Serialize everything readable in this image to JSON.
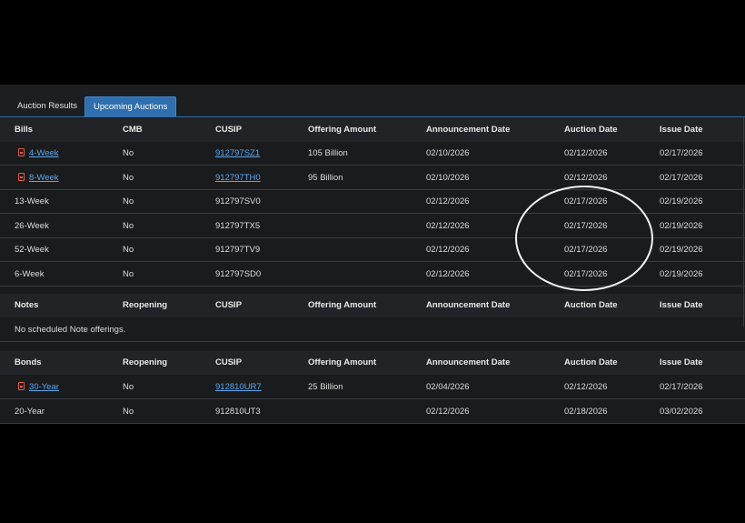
{
  "tabs": [
    {
      "label": "Auction Results",
      "active": false
    },
    {
      "label": "Upcoming Auctions",
      "active": true
    }
  ],
  "bills": {
    "headers": [
      "Bills",
      "CMB",
      "CUSIP",
      "Offering Amount",
      "Announcement Date",
      "Auction Date",
      "Issue Date"
    ],
    "rows": [
      {
        "term": "4-Week",
        "pdf": true,
        "cmb": "No",
        "cusip": "912797SZ1",
        "cusip_link": true,
        "offering": "105 Billion",
        "announcement": "02/10/2026",
        "auction": "02/12/2026",
        "issue": "02/17/2026"
      },
      {
        "term": "8-Week",
        "pdf": true,
        "cmb": "No",
        "cusip": "912797TH0",
        "cusip_link": true,
        "offering": "95 Billion",
        "announcement": "02/10/2026",
        "auction": "02/12/2026",
        "issue": "02/17/2026"
      },
      {
        "term": "13-Week",
        "pdf": false,
        "cmb": "No",
        "cusip": "912797SV0",
        "cusip_link": false,
        "offering": "",
        "announcement": "02/12/2026",
        "auction": "02/17/2026",
        "issue": "02/19/2026"
      },
      {
        "term": "26-Week",
        "pdf": false,
        "cmb": "No",
        "cusip": "912797TX5",
        "cusip_link": false,
        "offering": "",
        "announcement": "02/12/2026",
        "auction": "02/17/2026",
        "issue": "02/19/2026"
      },
      {
        "term": "52-Week",
        "pdf": false,
        "cmb": "No",
        "cusip": "912797TV9",
        "cusip_link": false,
        "offering": "",
        "announcement": "02/12/2026",
        "auction": "02/17/2026",
        "issue": "02/19/2026"
      },
      {
        "term": "6-Week",
        "pdf": false,
        "cmb": "No",
        "cusip": "912797SD0",
        "cusip_link": false,
        "offering": "",
        "announcement": "02/12/2026",
        "auction": "02/17/2026",
        "issue": "02/19/2026"
      }
    ]
  },
  "notes": {
    "headers": [
      "Notes",
      "Reopening",
      "CUSIP",
      "Offering Amount",
      "Announcement Date",
      "Auction Date",
      "Issue Date"
    ],
    "empty_message": "No scheduled Note offerings."
  },
  "bonds": {
    "headers": [
      "Bonds",
      "Reopening",
      "CUSIP",
      "Offering Amount",
      "Announcement Date",
      "Auction Date",
      "Issue Date"
    ],
    "rows": [
      {
        "term": "30-Year",
        "pdf": true,
        "cmb": "No",
        "cusip": "912810UR7",
        "cusip_link": true,
        "offering": "25 Billion",
        "announcement": "02/04/2026",
        "auction": "02/12/2026",
        "issue": "02/17/2026"
      },
      {
        "term": "20-Year",
        "pdf": false,
        "cmb": "No",
        "cusip": "912810UT3",
        "cusip_link": false,
        "offering": "",
        "announcement": "02/12/2026",
        "auction": "02/18/2026",
        "issue": "03/02/2026"
      }
    ]
  },
  "colors": {
    "accent": "#2f6fad",
    "link": "#5aa7ee",
    "pdf_icon": "#e05a4f",
    "annotation": "#f2f2f2"
  },
  "annotation": {
    "shape": "ellipse",
    "highlights": "auction-dates-02/17/2026"
  }
}
